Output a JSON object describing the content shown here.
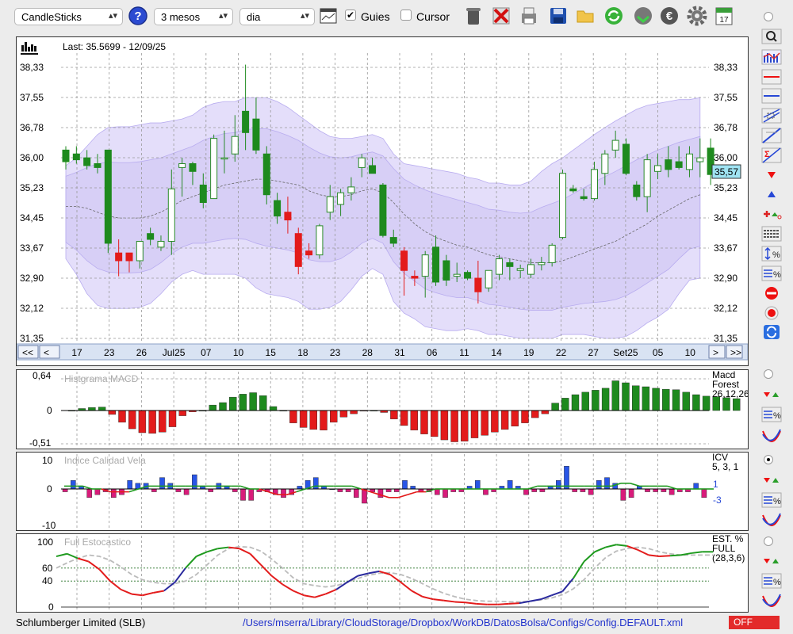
{
  "toolbar": {
    "chart_type": "CandleSticks",
    "period": "3 mesos",
    "interval": "dia",
    "guides_label": "Guies",
    "guides_checked": true,
    "cursor_label": "Cursor",
    "cursor_checked": false
  },
  "status": {
    "company": "Schlumberger Limited (SLB)",
    "path": "/Users/mserra/Library/CloudStorage/Dropbox/WorkDB/DatosBolsa/Configs/Config.DEFAULT.xml",
    "off_label": "OFF"
  },
  "colors": {
    "up": "#ffffff",
    "down": "#1e8a1e",
    "red": "#e31b1b",
    "blue": "#2855e6",
    "band": "#d9d2f5",
    "price_bg": "#9fe3f2"
  },
  "chart_data": [
    {
      "type": "candlestick",
      "last_label": "Last: 35.5699 - 12/09/25",
      "current_price": "35,57",
      "y_ticks": [
        "38,33",
        "37,55",
        "36,78",
        "36,00",
        "35,23",
        "34,45",
        "33,67",
        "32,90",
        "32,12",
        "31,35"
      ],
      "x_labels": [
        "17",
        "23",
        "26",
        "Jul25",
        "07",
        "10",
        "15",
        "18",
        "23",
        "28",
        "31",
        "06",
        "11",
        "14",
        "19",
        "22",
        "27",
        "Set25",
        "05",
        "10"
      ],
      "nav": {
        "first": "<<",
        "prev": "<",
        "next": ">",
        "last": ">>"
      },
      "candles": [
        [
          35.9,
          36.3,
          35.7,
          36.2,
          "g"
        ],
        [
          36.1,
          36.3,
          35.85,
          35.95,
          "g"
        ],
        [
          36.0,
          36.2,
          35.7,
          35.8,
          "g"
        ],
        [
          35.85,
          36.1,
          35.6,
          35.75,
          "g"
        ],
        [
          36.2,
          36.2,
          33.55,
          33.8,
          "g"
        ],
        [
          33.35,
          33.9,
          32.95,
          33.55,
          "r"
        ],
        [
          33.35,
          33.5,
          33.05,
          33.55,
          "r"
        ],
        [
          33.35,
          33.8,
          33.15,
          33.85,
          "w"
        ],
        [
          33.9,
          34.2,
          33.75,
          34.05,
          "g"
        ],
        [
          33.7,
          34.0,
          33.6,
          33.85,
          "w"
        ],
        [
          33.85,
          35.7,
          33.5,
          35.2,
          "w"
        ],
        [
          35.85,
          36.0,
          35.0,
          35.75,
          "w"
        ],
        [
          35.65,
          35.9,
          35.3,
          35.85,
          "g"
        ],
        [
          35.3,
          35.6,
          34.7,
          34.85,
          "g"
        ],
        [
          34.95,
          36.6,
          34.95,
          36.5,
          "w"
        ],
        [
          36.0,
          36.7,
          35.6,
          36.0,
          "w"
        ],
        [
          36.1,
          37.1,
          35.9,
          36.55,
          "w"
        ],
        [
          36.65,
          38.4,
          36.2,
          37.2,
          "g"
        ],
        [
          37.0,
          37.55,
          36.1,
          36.2,
          "g"
        ],
        [
          36.1,
          36.3,
          34.8,
          35.05,
          "g"
        ],
        [
          34.9,
          35.1,
          34.3,
          34.5,
          "g"
        ],
        [
          34.4,
          35.0,
          34.05,
          34.6,
          "r"
        ],
        [
          34.05,
          34.2,
          33.0,
          33.2,
          "r"
        ],
        [
          33.6,
          33.8,
          33.4,
          33.5,
          "r"
        ],
        [
          33.5,
          34.3,
          33.4,
          34.25,
          "w"
        ],
        [
          34.6,
          35.3,
          34.4,
          35.0,
          "w"
        ],
        [
          34.8,
          35.2,
          34.5,
          35.1,
          "w"
        ],
        [
          35.1,
          35.5,
          34.9,
          35.25,
          "w"
        ],
        [
          35.75,
          36.1,
          35.5,
          36.0,
          "w"
        ],
        [
          35.8,
          36.0,
          35.6,
          35.6,
          "g"
        ],
        [
          35.3,
          35.35,
          33.95,
          34.0,
          "g"
        ],
        [
          33.95,
          34.15,
          33.7,
          33.8,
          "g"
        ],
        [
          33.6,
          33.7,
          32.45,
          33.1,
          "r"
        ],
        [
          32.9,
          33.1,
          32.7,
          32.95,
          "r"
        ],
        [
          32.95,
          33.6,
          32.4,
          33.5,
          "w"
        ],
        [
          33.7,
          34.0,
          32.7,
          32.8,
          "g"
        ],
        [
          33.35,
          33.5,
          32.7,
          32.85,
          "g"
        ],
        [
          33.0,
          33.3,
          32.8,
          32.95,
          "w"
        ],
        [
          33.05,
          33.1,
          32.85,
          32.9,
          "g"
        ],
        [
          32.9,
          33.35,
          32.25,
          32.55,
          "r"
        ],
        [
          32.65,
          33.1,
          32.55,
          33.1,
          "w"
        ],
        [
          33.4,
          33.5,
          32.85,
          33.0,
          "w"
        ],
        [
          33.3,
          33.4,
          32.85,
          33.2,
          "g"
        ],
        [
          33.1,
          33.25,
          32.9,
          33.15,
          "w"
        ],
        [
          33.0,
          33.4,
          32.9,
          33.25,
          "w"
        ],
        [
          33.25,
          33.45,
          33.1,
          33.3,
          "w"
        ],
        [
          33.3,
          33.8,
          33.2,
          33.75,
          "w"
        ],
        [
          33.95,
          35.7,
          33.9,
          35.6,
          "w"
        ],
        [
          35.2,
          35.3,
          35.1,
          35.15,
          "g"
        ],
        [
          35.0,
          35.2,
          34.9,
          34.95,
          "g"
        ],
        [
          34.95,
          35.9,
          34.9,
          35.7,
          "w"
        ],
        [
          35.6,
          36.2,
          35.3,
          36.1,
          "w"
        ],
        [
          36.2,
          36.7,
          36.0,
          36.45,
          "w"
        ],
        [
          36.35,
          36.5,
          35.55,
          35.6,
          "g"
        ],
        [
          35.3,
          35.4,
          34.9,
          35.0,
          "g"
        ],
        [
          35.0,
          36.1,
          34.6,
          35.95,
          "w"
        ],
        [
          35.8,
          36.1,
          35.45,
          35.65,
          "w"
        ],
        [
          35.95,
          36.3,
          35.5,
          35.7,
          "g"
        ],
        [
          35.9,
          36.3,
          35.7,
          35.75,
          "g"
        ],
        [
          35.7,
          36.3,
          35.5,
          36.1,
          "w"
        ],
        [
          35.9,
          36.5,
          35.5,
          36.0,
          "w"
        ],
        [
          36.25,
          36.5,
          35.3,
          35.57,
          "g"
        ]
      ],
      "bollinger_upper": [
        35.8,
        36.0,
        36.3,
        36.6,
        36.78,
        36.8,
        36.8,
        36.85,
        36.9,
        36.9,
        36.95,
        37.0,
        37.1,
        37.3,
        37.4,
        37.45,
        37.45,
        37.55,
        37.55,
        37.55,
        37.45,
        37.3,
        37.1,
        36.9,
        36.7,
        36.55,
        36.5,
        36.5,
        36.55,
        36.6,
        36.5,
        36.1,
        35.85,
        35.8,
        35.75,
        35.7,
        35.65,
        35.6,
        35.5,
        35.45,
        35.35,
        35.35,
        35.3,
        35.3,
        35.4,
        35.65,
        35.85,
        36.0,
        36.2,
        36.4,
        36.6,
        36.78,
        36.95,
        37.1,
        37.25,
        37.35,
        37.4,
        37.45,
        37.5,
        37.5,
        37.55
      ],
      "bollinger_mid": [
        34.75,
        34.75,
        34.7,
        34.6,
        34.5,
        34.45,
        34.45,
        34.45,
        34.5,
        34.6,
        34.75,
        34.9,
        35.0,
        35.1,
        35.2,
        35.3,
        35.35,
        35.4,
        35.45,
        35.45,
        35.4,
        35.35,
        35.3,
        35.15,
        35.05,
        35.0,
        35.0,
        35.05,
        35.15,
        35.2,
        35.1,
        34.85,
        34.55,
        34.3,
        34.1,
        33.95,
        33.85,
        33.75,
        33.7,
        33.6,
        33.5,
        33.45,
        33.4,
        33.35,
        33.3,
        33.3,
        33.3,
        33.35,
        33.45,
        33.55,
        33.65,
        33.75,
        33.85,
        34.0,
        34.15,
        34.3,
        34.5,
        34.65,
        34.8,
        34.95,
        35.05
      ],
      "bollinger_lower": [
        33.4,
        33.0,
        32.5,
        32.2,
        32.12,
        32.12,
        32.12,
        32.15,
        32.25,
        32.5,
        32.8,
        33.0,
        33.1,
        33.0,
        33.0,
        33.0,
        33.0,
        32.9,
        32.65,
        32.5,
        32.45,
        32.4,
        32.3,
        32.1,
        32.1,
        32.15,
        32.3,
        32.6,
        32.95,
        33.15,
        33.0,
        32.3,
        32.0,
        31.85,
        31.65,
        31.6,
        31.55,
        31.55,
        31.6,
        31.55,
        31.45,
        31.45,
        31.4,
        31.35,
        31.35,
        31.35,
        31.35,
        31.45,
        31.45,
        31.45,
        31.4,
        31.35,
        31.35,
        31.4,
        31.55,
        31.75,
        31.9,
        32.1,
        32.5,
        32.85,
        32.9
      ]
    },
    {
      "type": "bar",
      "title": "Histgrama MACD",
      "legend": [
        "Macd",
        "Forest",
        "26,12,26"
      ],
      "y_ticks": [
        "0,64",
        "0",
        "-0,51"
      ],
      "ylim": [
        -0.51,
        0.64
      ],
      "values": [
        0.0,
        0.04,
        0.06,
        0.07,
        -0.06,
        -0.18,
        -0.28,
        -0.34,
        -0.35,
        -0.33,
        -0.25,
        -0.08,
        -0.02,
        0.0,
        0.11,
        0.16,
        0.27,
        0.33,
        0.36,
        0.3,
        0.08,
        0.0,
        -0.19,
        -0.26,
        -0.29,
        -0.3,
        -0.18,
        -0.1,
        -0.05,
        -0.01,
        0.0,
        -0.03,
        -0.13,
        -0.23,
        -0.3,
        -0.36,
        -0.4,
        -0.45,
        -0.48,
        -0.47,
        -0.42,
        -0.38,
        -0.33,
        -0.29,
        -0.24,
        -0.19,
        -0.11,
        -0.05,
        0.15,
        0.25,
        0.32,
        0.37,
        0.41,
        0.45,
        0.6,
        0.56,
        0.5,
        0.48,
        0.45,
        0.43,
        0.42,
        0.37,
        0.32,
        0.29,
        0.28,
        0.26,
        0.24
      ]
    },
    {
      "type": "bar",
      "title": "Indice Calidad Vela",
      "legend": [
        "ICV",
        "5, 3, 1"
      ],
      "y_ticks": [
        "10",
        "0",
        "-10"
      ],
      "ylim": [
        -10,
        10
      ],
      "ref_hi": "1",
      "ref_lo": "-3",
      "values": [
        -1,
        3,
        1,
        -3,
        -2,
        -1,
        -3,
        -2,
        3,
        2,
        2,
        -1,
        4,
        2,
        -1,
        -2,
        5,
        1,
        -1,
        2,
        1,
        -1,
        -4,
        -4,
        -1,
        -1,
        -2,
        -3,
        -2,
        1,
        3,
        4,
        1,
        0,
        -1,
        -1,
        -3,
        -5,
        -1,
        -3,
        -1,
        -1,
        3,
        1,
        -1,
        -1,
        -2,
        -3,
        -1,
        -1,
        1,
        3,
        -2,
        -1,
        1,
        3,
        1,
        -2,
        -1,
        -1,
        1,
        3,
        8,
        -1,
        -1,
        -2,
        3,
        4,
        2,
        -4,
        -3,
        1,
        -1,
        -1,
        -1,
        -2,
        -1,
        -1,
        2,
        -3
      ],
      "line": [
        1,
        1,
        1,
        0,
        0,
        -1,
        -1,
        -1,
        0,
        1,
        1,
        1,
        1,
        1,
        1,
        1,
        1,
        1,
        1,
        1,
        0,
        0,
        -1,
        -2,
        -2,
        -1,
        0,
        1,
        1,
        1,
        1,
        1,
        0,
        -1,
        -2,
        -3,
        -3,
        -2,
        -1,
        -1,
        0,
        0,
        0,
        0,
        0,
        0,
        0,
        0,
        0,
        0,
        0,
        1,
        1,
        1,
        1,
        1,
        1,
        1,
        1,
        1,
        2,
        2,
        1,
        1,
        1,
        1,
        0,
        0,
        0,
        0,
        0
      ]
    },
    {
      "type": "line",
      "title": "Full Estocastico",
      "legend": [
        "EST. %",
        "FULL",
        "(28,3,6)"
      ],
      "y_ticks": [
        "100",
        "60",
        "40",
        "0"
      ],
      "ylim": [
        0,
        100
      ],
      "k": [
        78,
        82,
        75,
        70,
        58,
        40,
        27,
        20,
        18,
        22,
        25,
        38,
        60,
        78,
        85,
        90,
        92,
        90,
        82,
        65,
        48,
        35,
        25,
        18,
        15,
        20,
        27,
        38,
        48,
        52,
        55,
        50,
        38,
        25,
        16,
        12,
        10,
        8,
        7,
        5,
        4,
        4,
        5,
        6,
        9,
        12,
        18,
        24,
        44,
        70,
        85,
        92,
        96,
        94,
        88,
        80,
        78,
        79,
        80,
        83,
        85,
        85
      ],
      "d": [
        60,
        68,
        75,
        80,
        78,
        72,
        62,
        50,
        42,
        38,
        36,
        36,
        40,
        50,
        65,
        80,
        90,
        93,
        92,
        86,
        74,
        60,
        45,
        36,
        33,
        31,
        33,
        38,
        44,
        49,
        52,
        53,
        50,
        44,
        36,
        28,
        21,
        16,
        12,
        10,
        9,
        9,
        8,
        8,
        9,
        11,
        14,
        19,
        28,
        42,
        60,
        76,
        86,
        90,
        92,
        90,
        85,
        82,
        80,
        80,
        80,
        80
      ]
    }
  ]
}
